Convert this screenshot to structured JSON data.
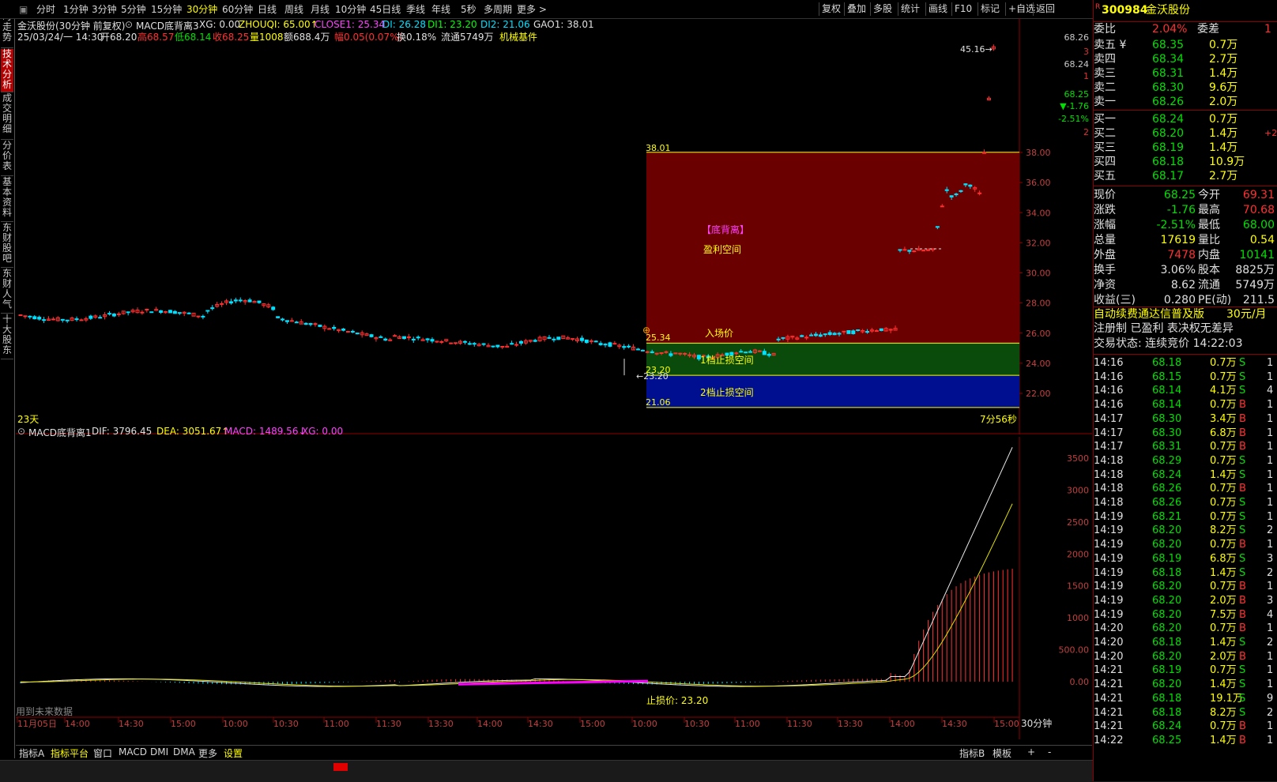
{
  "toolbar": {
    "periods": [
      "分时",
      "1分钟",
      "3分钟",
      "5分钟",
      "15分钟",
      "30分钟",
      "60分钟",
      "日线",
      "周线",
      "月线",
      "10分钟",
      "45日线",
      "季线",
      "年线",
      "5秒",
      "多周期",
      "更多 >"
    ],
    "active_period": "30分钟",
    "right_buttons": [
      "复权",
      "叠加",
      "多股",
      "统计",
      "画线",
      "F10",
      "标记",
      "+自选",
      "返回"
    ]
  },
  "left_tabs": [
    "分时走势",
    "技术分析",
    "成交明细",
    "分价表",
    "基本资料",
    "东财股吧",
    "东财人气",
    "十大股东"
  ],
  "left_tab_active": "技术分析",
  "main": {
    "title": "金沃股份(30分钟 前复权)",
    "indicator_name": "MACD底背离3",
    "ind_xg": "XG: 0.00",
    "ind_zhouqi": "ZHOUQI: 65.00↑",
    "ind_close1": "CLOSE1: 25.34",
    "ind_di": "DI: 26.28",
    "ind_di1": "DI1: 23.20",
    "ind_di2": "DI2: 21.06",
    "ind_gao1": "GAO1: 38.01",
    "info_date": "25/03/24/一 14:30",
    "info_open": "开68.20",
    "info_high": "高68.57",
    "info_low": "低68.14",
    "info_close": "收68.25",
    "info_vol": "量1008",
    "info_amount": "额688.4万",
    "info_range": "幅0.05(0.07%)",
    "info_turnover": "换0.18%",
    "info_float": "流通5749万",
    "info_sector": "机械基件",
    "label_23days": "23天",
    "label_countdown": "7分56秒",
    "zone_high": "38.01",
    "zone_entry": "25.34",
    "zone_stop1": "23.20",
    "zone_stop2": "21.06",
    "text_divergence": "【底背离】",
    "text_profit": "盈利空间",
    "text_entry": "入场价",
    "text_stop1": "1档止损空间",
    "text_stop2": "2档止损空间",
    "low_mark": "23.20",
    "high_mark": "45.16",
    "y_ticks": [
      "38.00",
      "36.00",
      "34.00",
      "32.00",
      "30.00",
      "28.00",
      "26.00",
      "24.00",
      "22.00"
    ],
    "y_top": [
      {
        "v": "68.26",
        "c": "#c8c8c8"
      },
      {
        "v": "3",
        "c": "#e03030"
      },
      {
        "v": "68.24",
        "c": "#c8c8c8"
      },
      {
        "v": "1",
        "c": "#e03030"
      },
      {
        "v": "68.25",
        "c": "#00e000"
      },
      {
        "v": "▼-1.76",
        "c": "#00e000"
      },
      {
        "v": "-2.51%",
        "c": "#00e000"
      },
      {
        "v": "2",
        "c": "#e03030"
      }
    ]
  },
  "macd": {
    "name": "MACD底背离1",
    "dif": "DIF: 3796.45",
    "dea": "DEA: 3051.67↑",
    "macd": "MACD: 1489.56↓",
    "xg": "XG: 0.00",
    "stop_text": "止损价:  23.20",
    "future_text": "用到未来数据",
    "y_ticks": [
      "3500",
      "3000",
      "2500",
      "2000",
      "1500",
      "1000",
      "500.00",
      "0.00"
    ],
    "x_ticks": [
      "11月05日",
      "14:00",
      "14:30",
      "15:00",
      "10:00",
      "10:30",
      "11:00",
      "11:30",
      "13:30",
      "14:00",
      "14:30",
      "15:00",
      "10:00",
      "10:30",
      "11:00",
      "11:30",
      "13:30",
      "14:00",
      "14:30",
      "15:00"
    ],
    "period_label": "30分钟"
  },
  "bottom_tabs": [
    "指标A",
    "指标平台",
    "窗口",
    "MACD",
    "DMI",
    "DMA",
    "更多",
    "设置"
  ],
  "bottom_right": [
    "指标B",
    "模板",
    "+",
    "-"
  ],
  "quote": {
    "code": "300984",
    "name": "金沃股份",
    "wb_label": "委比",
    "wb_value": "2.04%",
    "wc_label": "委差",
    "wc_value": "1",
    "asks": [
      {
        "label": "卖五 ¥",
        "price": "68.35",
        "vol": "0.7万"
      },
      {
        "label": "卖四",
        "price": "68.34",
        "vol": "2.7万"
      },
      {
        "label": "卖三",
        "price": "68.31",
        "vol": "1.4万"
      },
      {
        "label": "卖二",
        "price": "68.30",
        "vol": "9.6万"
      },
      {
        "label": "卖一",
        "price": "68.26",
        "vol": "2.0万"
      }
    ],
    "bids": [
      {
        "label": "买一",
        "price": "68.24",
        "vol": "0.7万",
        "extra": ""
      },
      {
        "label": "买二",
        "price": "68.20",
        "vol": "1.4万",
        "extra": "+2"
      },
      {
        "label": "买三",
        "price": "68.19",
        "vol": "1.4万",
        "extra": ""
      },
      {
        "label": "买四",
        "price": "68.18",
        "vol": "10.9万",
        "extra": ""
      },
      {
        "label": "买五",
        "price": "68.17",
        "vol": "2.7万",
        "extra": ""
      }
    ],
    "stats": [
      {
        "l1": "现价",
        "v1": "68.25",
        "c1": "#00e000",
        "l2": "今开",
        "v2": "69.31",
        "c2": "#ff3030"
      },
      {
        "l1": "涨跌",
        "v1": "-1.76",
        "c1": "#00e000",
        "l2": "最高",
        "v2": "70.68",
        "c2": "#ff3030"
      },
      {
        "l1": "涨幅",
        "v1": "-2.51%",
        "c1": "#00e000",
        "l2": "最低",
        "v2": "68.00",
        "c2": "#00e000"
      },
      {
        "l1": "总量",
        "v1": "17619",
        "c1": "#ffff00",
        "l2": "量比",
        "v2": "0.54",
        "c2": "#ffff00"
      },
      {
        "l1": "外盘",
        "v1": "7478",
        "c1": "#ff3030",
        "l2": "内盘",
        "v2": "10141",
        "c2": "#00e000"
      },
      {
        "l1": "换手",
        "v1": "3.06%",
        "c1": "#e0e0e0",
        "l2": "股本",
        "v2": "8825万",
        "c2": "#e0e0e0"
      },
      {
        "l1": "净资",
        "v1": "8.62",
        "c1": "#e0e0e0",
        "l2": "流通",
        "v2": "5749万",
        "c2": "#e0e0e0"
      },
      {
        "l1": "收益(三)",
        "v1": "0.280",
        "c1": "#e0e0e0",
        "l2": "PE(动)",
        "v2": "211.5",
        "c2": "#e0e0e0"
      }
    ],
    "promo": "自动续费通达信普及版",
    "promo_price": "30元/月",
    "features": "注册制  已盈利  表决权无差异",
    "trade_state": "交易状态: 连续竞价 14:22:03",
    "ticks": [
      {
        "t": "14:16",
        "p": "68.18",
        "v": "0.7万",
        "s": "S",
        "n": "1"
      },
      {
        "t": "14:16",
        "p": "68.15",
        "v": "0.7万",
        "s": "S",
        "n": "1"
      },
      {
        "t": "14:16",
        "p": "68.14",
        "v": "4.1万",
        "s": "S",
        "n": "4"
      },
      {
        "t": "14:16",
        "p": "68.14",
        "v": "0.7万",
        "s": "B",
        "n": "1"
      },
      {
        "t": "14:17",
        "p": "68.30",
        "v": "3.4万",
        "s": "B",
        "n": "1"
      },
      {
        "t": "14:17",
        "p": "68.30",
        "v": "6.8万",
        "s": "B",
        "n": "1"
      },
      {
        "t": "14:17",
        "p": "68.31",
        "v": "0.7万",
        "s": "B",
        "n": "1"
      },
      {
        "t": "14:18",
        "p": "68.29",
        "v": "0.7万",
        "s": "S",
        "n": "1"
      },
      {
        "t": "14:18",
        "p": "68.24",
        "v": "1.4万",
        "s": "S",
        "n": "1"
      },
      {
        "t": "14:18",
        "p": "68.26",
        "v": "0.7万",
        "s": "B",
        "n": "1"
      },
      {
        "t": "14:18",
        "p": "68.26",
        "v": "0.7万",
        "s": "S",
        "n": "1"
      },
      {
        "t": "14:19",
        "p": "68.21",
        "v": "0.7万",
        "s": "S",
        "n": "1"
      },
      {
        "t": "14:19",
        "p": "68.20",
        "v": "8.2万",
        "s": "S",
        "n": "2"
      },
      {
        "t": "14:19",
        "p": "68.20",
        "v": "0.7万",
        "s": "B",
        "n": "1"
      },
      {
        "t": "14:19",
        "p": "68.19",
        "v": "6.8万",
        "s": "S",
        "n": "3"
      },
      {
        "t": "14:19",
        "p": "68.18",
        "v": "1.4万",
        "s": "S",
        "n": "2"
      },
      {
        "t": "14:19",
        "p": "68.20",
        "v": "0.7万",
        "s": "B",
        "n": "1"
      },
      {
        "t": "14:19",
        "p": "68.20",
        "v": "2.0万",
        "s": "B",
        "n": "3"
      },
      {
        "t": "14:19",
        "p": "68.20",
        "v": "7.5万",
        "s": "B",
        "n": "4"
      },
      {
        "t": "14:20",
        "p": "68.20",
        "v": "0.7万",
        "s": "B",
        "n": "1"
      },
      {
        "t": "14:20",
        "p": "68.18",
        "v": "1.4万",
        "s": "S",
        "n": "2"
      },
      {
        "t": "14:20",
        "p": "68.20",
        "v": "2.0万",
        "s": "B",
        "n": "1"
      },
      {
        "t": "14:21",
        "p": "68.19",
        "v": "0.7万",
        "s": "S",
        "n": "1"
      },
      {
        "t": "14:21",
        "p": "68.20",
        "v": "1.4万",
        "s": "S",
        "n": "1"
      },
      {
        "t": "14:21",
        "p": "68.18",
        "v": "19.1万",
        "s": "S",
        "n": "9"
      },
      {
        "t": "14:21",
        "p": "68.18",
        "v": "8.2万",
        "s": "S",
        "n": "2"
      },
      {
        "t": "14:21",
        "p": "68.24",
        "v": "0.7万",
        "s": "B",
        "n": "1"
      },
      {
        "t": "14:22",
        "p": "68.25",
        "v": "1.4万",
        "s": "B",
        "n": "1"
      }
    ]
  },
  "colors": {
    "up": "#ff3030",
    "down": "#00e0ff",
    "zone_profit": "#6b0000",
    "zone_stop1": "#0a4a0a",
    "zone_stop2": "#000f8f"
  }
}
